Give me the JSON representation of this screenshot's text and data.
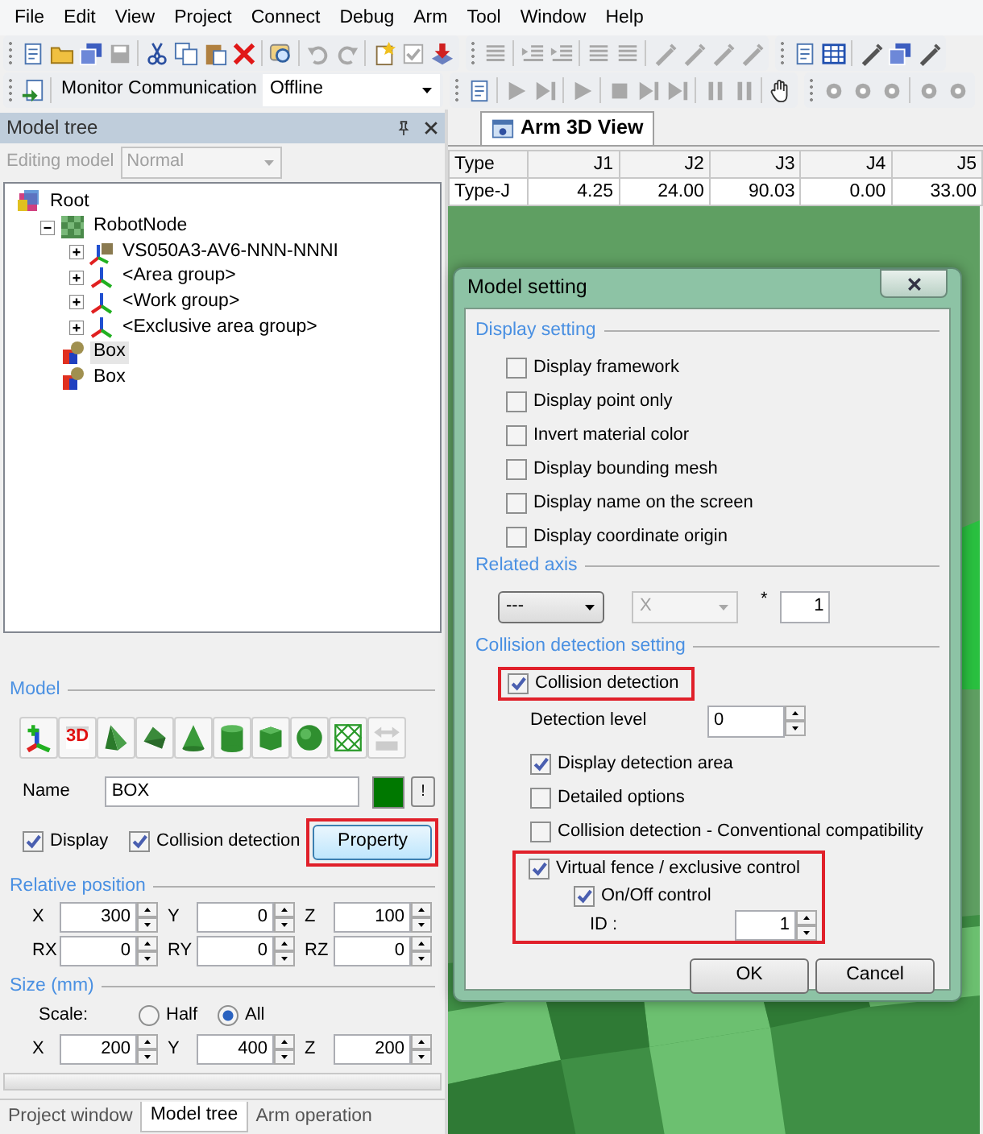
{
  "menu": [
    "File",
    "Edit",
    "View",
    "Project",
    "Connect",
    "Debug",
    "Arm",
    "Tool",
    "Window",
    "Help"
  ],
  "toolbars": [
    [
      [
        {
          "kind": "button",
          "disabled": false
        },
        {
          "kind": "button",
          "disabled": false
        },
        {
          "kind": "button",
          "disabled": false
        },
        {
          "kind": "button",
          "disabled": true
        },
        {
          "kind": "separator"
        },
        {
          "kind": "button",
          "disabled": false
        },
        {
          "kind": "button",
          "disabled": false
        },
        {
          "kind": "button",
          "disabled": false
        },
        {
          "kind": "button",
          "disabled": false
        },
        {
          "kind": "separator"
        },
        {
          "kind": "button",
          "disabled": false
        },
        {
          "kind": "separator"
        },
        {
          "kind": "button",
          "disabled": true
        },
        {
          "kind": "button",
          "disabled": true
        },
        {
          "kind": "separator"
        },
        {
          "kind": "button",
          "disabled": false
        },
        {
          "kind": "button",
          "disabled": true
        },
        {
          "kind": "button",
          "disabled": false
        }
      ],
      [
        {
          "kind": "button",
          "disabled": true
        },
        {
          "kind": "separator"
        },
        {
          "kind": "button",
          "disabled": true
        },
        {
          "kind": "button",
          "disabled": true
        },
        {
          "kind": "separator"
        },
        {
          "kind": "button",
          "disabled": true
        },
        {
          "kind": "button",
          "disabled": true
        },
        {
          "kind": "separator"
        },
        {
          "kind": "button",
          "disabled": true
        },
        {
          "kind": "button",
          "disabled": true
        },
        {
          "kind": "button",
          "disabled": true
        },
        {
          "kind": "button",
          "disabled": true
        }
      ],
      [
        {
          "kind": "button",
          "disabled": false
        },
        {
          "kind": "button",
          "disabled": false
        },
        {
          "kind": "separator"
        },
        {
          "kind": "button",
          "disabled": false
        },
        {
          "kind": "button",
          "disabled": false
        },
        {
          "kind": "button",
          "disabled": false
        }
      ]
    ],
    [
      [
        {
          "kind": "button",
          "disabled": false
        },
        {
          "kind": "separator"
        },
        {
          "kind": "label",
          "text": "Monitor Communication"
        },
        {
          "kind": "combo",
          "value": "Offline"
        }
      ],
      [
        {
          "kind": "button",
          "disabled": false
        },
        {
          "kind": "separator"
        },
        {
          "kind": "button",
          "disabled": true
        },
        {
          "kind": "button",
          "disabled": true
        },
        {
          "kind": "separator"
        },
        {
          "kind": "button",
          "disabled": true
        },
        {
          "kind": "separator"
        },
        {
          "kind": "button",
          "disabled": true
        },
        {
          "kind": "button",
          "disabled": true
        },
        {
          "kind": "button",
          "disabled": true
        },
        {
          "kind": "separator"
        },
        {
          "kind": "button",
          "disabled": true
        },
        {
          "kind": "button",
          "disabled": true
        },
        {
          "kind": "separator"
        },
        {
          "kind": "button",
          "disabled": false
        }
      ],
      [
        {
          "kind": "button",
          "disabled": true
        },
        {
          "kind": "button",
          "disabled": true
        },
        {
          "kind": "button",
          "disabled": true
        },
        {
          "kind": "separator"
        },
        {
          "kind": "button",
          "disabled": true
        },
        {
          "kind": "button",
          "disabled": true
        }
      ]
    ]
  ],
  "left_panel": {
    "title": "Model tree",
    "editing_model": {
      "label": "Editing model",
      "value": "Normal",
      "disabled": true
    },
    "tree": [
      {
        "label": "Root",
        "kind": "root",
        "selected": false,
        "children": [
          {
            "label": "RobotNode",
            "kind": "node",
            "expanded": true,
            "selected": false,
            "children": [
              {
                "label": "VS050A3-AV6-NNN-NNNI",
                "kind": "robot",
                "expanded": false,
                "selected": false
              },
              {
                "label": "<Area group>",
                "kind": "group",
                "expanded": false,
                "selected": false
              },
              {
                "label": "<Work group>",
                "kind": "group",
                "expanded": false,
                "selected": false
              },
              {
                "label": "<Exclusive area group>",
                "kind": "group",
                "expanded": false,
                "selected": false
              }
            ]
          },
          {
            "label": "Box",
            "kind": "part",
            "selected": true
          },
          {
            "label": "Box",
            "kind": "part",
            "selected": false
          }
        ]
      }
    ],
    "model": {
      "legend": "Model",
      "shape_buttons": [
        {
          "disabled": false
        },
        {
          "disabled": false,
          "label": "3D"
        },
        {
          "disabled": false
        },
        {
          "disabled": false
        },
        {
          "disabled": false
        },
        {
          "disabled": false
        },
        {
          "disabled": false
        },
        {
          "disabled": false
        },
        {
          "disabled": false
        },
        {
          "disabled": true
        }
      ],
      "name_label": "Name",
      "name_value": "BOX",
      "color": "#007800",
      "color_button": "!",
      "display": {
        "label": "Display",
        "checked": true
      },
      "collision": {
        "label": "Collision detection",
        "checked": true
      },
      "property_button": {
        "label": "Property",
        "highlighted": true
      }
    },
    "relative_position": {
      "legend": "Relative position",
      "fields": [
        {
          "label": "X",
          "value": "300"
        },
        {
          "label": "Y",
          "value": "0"
        },
        {
          "label": "Z",
          "value": "100"
        },
        {
          "label": "RX",
          "value": "0"
        },
        {
          "label": "RY",
          "value": "0"
        },
        {
          "label": "RZ",
          "value": "0"
        }
      ]
    },
    "size": {
      "legend": "Size (mm)",
      "scale_label": "Scale:",
      "scale_options": [
        {
          "label": "Half",
          "selected": false
        },
        {
          "label": "All",
          "selected": true
        }
      ],
      "fields": [
        {
          "label": "X",
          "value": "200"
        },
        {
          "label": "Y",
          "value": "400"
        },
        {
          "label": "Z",
          "value": "200"
        }
      ]
    },
    "bottom_tabs": [
      {
        "label": "Project window",
        "selected": false
      },
      {
        "label": "Model tree",
        "selected": true
      },
      {
        "label": "Arm operation",
        "selected": false
      }
    ]
  },
  "document_tabs": [
    {
      "label": "Arm 3D View",
      "selected": true
    }
  ],
  "joint_table": {
    "columns": [
      "Type",
      "J1",
      "J2",
      "J3",
      "J4",
      "J5"
    ],
    "rows": [
      [
        "Type-J",
        "4.25",
        "24.00",
        "90.03",
        "0.00",
        "33.00"
      ]
    ]
  },
  "dialog": {
    "title": "Model setting",
    "display_setting": {
      "legend": "Display setting",
      "options": [
        {
          "label": "Display framework",
          "checked": false
        },
        {
          "label": "Display point only",
          "checked": false
        },
        {
          "label": "Invert material color",
          "checked": false
        },
        {
          "label": "Display bounding mesh",
          "checked": false
        },
        {
          "label": "Display name on the screen",
          "checked": false
        },
        {
          "label": "Display coordinate origin",
          "checked": false
        }
      ]
    },
    "related_axis": {
      "legend": "Related axis",
      "axis": {
        "value": "---",
        "disabled": false
      },
      "direction": {
        "value": "X",
        "disabled": true
      },
      "multiplier_label": "*",
      "multiplier": "1"
    },
    "collision_setting": {
      "legend": "Collision detection setting",
      "collision_detection": {
        "label": "Collision detection",
        "checked": true,
        "highlighted": true
      },
      "detection_level": {
        "label": "Detection level",
        "value": "0"
      },
      "options": [
        {
          "label": "Display detection area",
          "checked": true
        },
        {
          "label": "Detailed options",
          "checked": false
        },
        {
          "label": "Collision detection - Conventional compatibility",
          "checked": false
        }
      ],
      "virtual_fence": {
        "label": "Virtual fence / exclusive control",
        "checked": true,
        "highlighted": true,
        "on_off": {
          "label": "On/Off control",
          "checked": true
        },
        "id": {
          "label": "ID :",
          "value": "1"
        }
      }
    },
    "buttons": [
      "OK",
      "Cancel"
    ]
  }
}
